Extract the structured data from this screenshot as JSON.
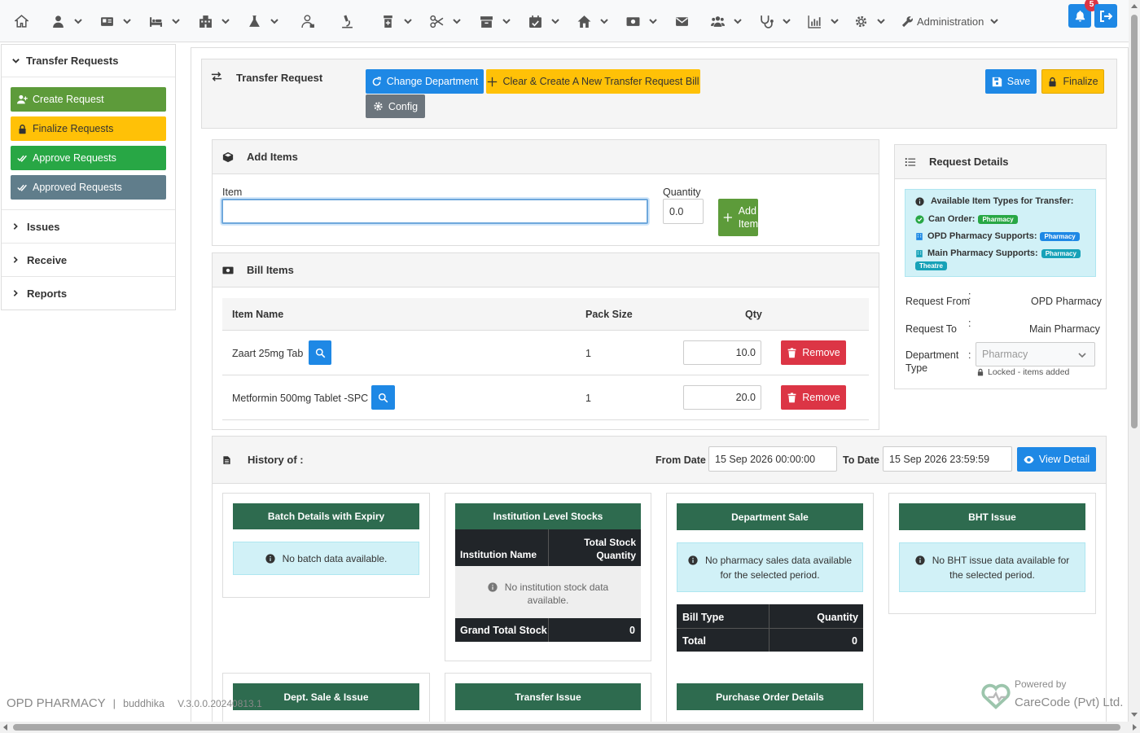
{
  "nav": {
    "admin_label": "Administration",
    "notification_count": "5"
  },
  "sidebar": {
    "title": "Transfer Requests",
    "buttons": [
      {
        "label": "Create Request",
        "color": "#5d9b3a"
      },
      {
        "label": "Finalize Requests",
        "color": "#ffc107"
      },
      {
        "label": "Approve Requests",
        "color": "#28a745"
      },
      {
        "label": "Approved Requests",
        "color": "#607d8b"
      }
    ],
    "sections": [
      "Issues",
      "Receive",
      "Reports"
    ]
  },
  "header": {
    "title": "Transfer Request",
    "change_department": "Change Department",
    "clear_create": "Clear & Create A New Transfer Request Bill",
    "config": "Config",
    "save": "Save",
    "finalize": "Finalize"
  },
  "add_items": {
    "title": "Add Items",
    "item_label": "Item",
    "item_value": "",
    "quantity_label": "Quantity",
    "quantity_value": "0.0",
    "add_button_line1": "Add",
    "add_button_line2": "Item"
  },
  "bill_items": {
    "title": "Bill Items",
    "columns": [
      "Item Name",
      "Pack Size",
      "Qty"
    ],
    "rows": [
      {
        "name": "Zaart 25mg Tab",
        "pack_size": "1",
        "qty": "10.0",
        "remove": "Remove"
      },
      {
        "name": "Metformin 500mg Tablet -SPC",
        "pack_size": "1",
        "qty": "20.0",
        "remove": "Remove"
      }
    ]
  },
  "request_details": {
    "title": "Request Details",
    "available_title": "Available Item Types for Transfer:",
    "can_order_label": "Can Order:",
    "can_order_badge": "Pharmacy",
    "opd_supports_label": "OPD Pharmacy Supports:",
    "opd_supports_badge": "Pharmacy",
    "main_supports_label": "Main Pharmacy Supports:",
    "main_supports_badges": [
      "Pharmacy",
      "Theatre"
    ],
    "request_from_label": "Request From",
    "request_from_value": "OPD Pharmacy",
    "request_to_label": "Request To",
    "request_to_value": "Main Pharmacy",
    "department_type_label_1": "Department",
    "department_type_label_2": "Type",
    "department_type_value": "Pharmacy",
    "locked_note": "Locked - items added",
    "colon": ":"
  },
  "history": {
    "title": "History of :",
    "from_label": "From Date",
    "from_value": "15 Sep 2026 00:00:00",
    "to_label": "To Date",
    "to_value": "15 Sep 2026 23:59:59",
    "view_detail": "View Detail"
  },
  "cards": {
    "batch": {
      "title": "Batch Details with Expiry",
      "message": "No batch data available."
    },
    "institution": {
      "title": "Institution Level Stocks",
      "col1": "Institution Name",
      "col2_line1": "Total Stock",
      "col2_line2": "Quantity",
      "message_line1": "No institution stock data",
      "message_line2": "available.",
      "grand_total_label": "Grand Total Stock",
      "grand_total_value": "0"
    },
    "dept_sale": {
      "title": "Department Sale",
      "message_line1": "No pharmacy sales data available",
      "message_line2": "for the selected period.",
      "col1": "Bill Type",
      "col2": "Quantity",
      "total_label": "Total",
      "total_value": "0"
    },
    "bht": {
      "title": "BHT Issue",
      "message_line1": "No BHT issue data available for",
      "message_line2": "the selected period."
    },
    "dept_sale_issue": {
      "title": "Dept. Sale & Issue"
    },
    "transfer_issue": {
      "title": "Transfer Issue"
    },
    "purchase_order": {
      "title": "Purchase Order Details"
    }
  },
  "footer": {
    "department": "OPD PHARMACY",
    "separator": "|",
    "user": "buddhika",
    "version": "V.3.0.0.20240813.1",
    "powered_by": "Powered by",
    "company": "CareCode (Pvt) Ltd."
  },
  "colors": {
    "primary": "#1e88e5",
    "warning": "#ffc107",
    "success": "#28a745",
    "secondary": "#607d8b",
    "danger": "#dc3545",
    "dark_green": "#2e6b4f",
    "info_bg": "#d1f1f7"
  }
}
